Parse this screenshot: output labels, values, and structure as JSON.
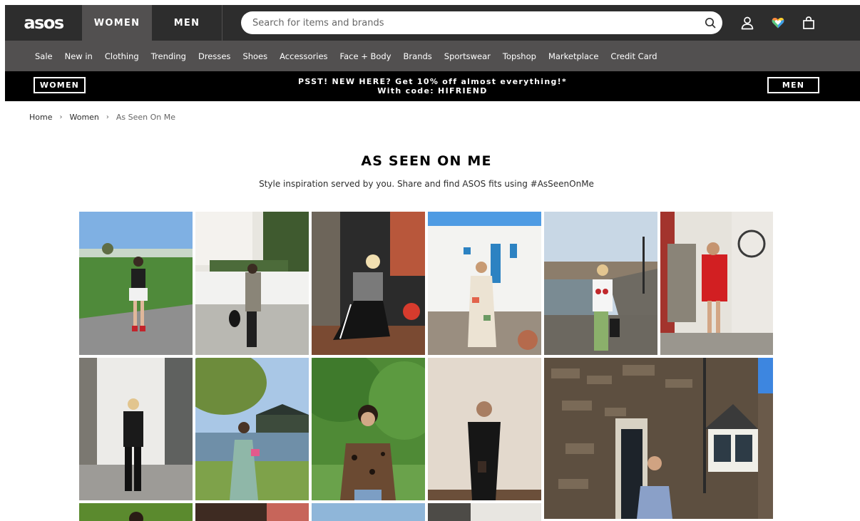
{
  "header": {
    "logo": "asos",
    "tabs": [
      {
        "label": "WOMEN"
      },
      {
        "label": "MEN"
      }
    ],
    "search_placeholder": "Search for items and brands"
  },
  "nav": {
    "items": [
      "Sale",
      "New in",
      "Clothing",
      "Trending",
      "Dresses",
      "Shoes",
      "Accessories",
      "Face + Body",
      "Brands",
      "Sportswear",
      "Topshop",
      "Marketplace",
      "Credit Card"
    ]
  },
  "promo": {
    "left_button": "WOMEN",
    "right_button": "MEN",
    "line1": "PSST! NEW HERE? Get 10% off almost everything!*",
    "line2": "With code: HIFRIEND"
  },
  "breadcrumb": {
    "items": [
      "Home",
      "Women",
      "As Seen On Me"
    ]
  },
  "page": {
    "title": "AS SEEN ON ME",
    "subtitle": "Style inspiration served by you. Share and find ASOS fits using #AsSeenOnMe"
  },
  "colors": {
    "header_bg": "#2d2d2d",
    "nav_bg": "#525050",
    "promo_bg": "#000000"
  },
  "icons": [
    "search-icon",
    "account-icon",
    "saved-items-heart-icon",
    "bag-icon"
  ]
}
